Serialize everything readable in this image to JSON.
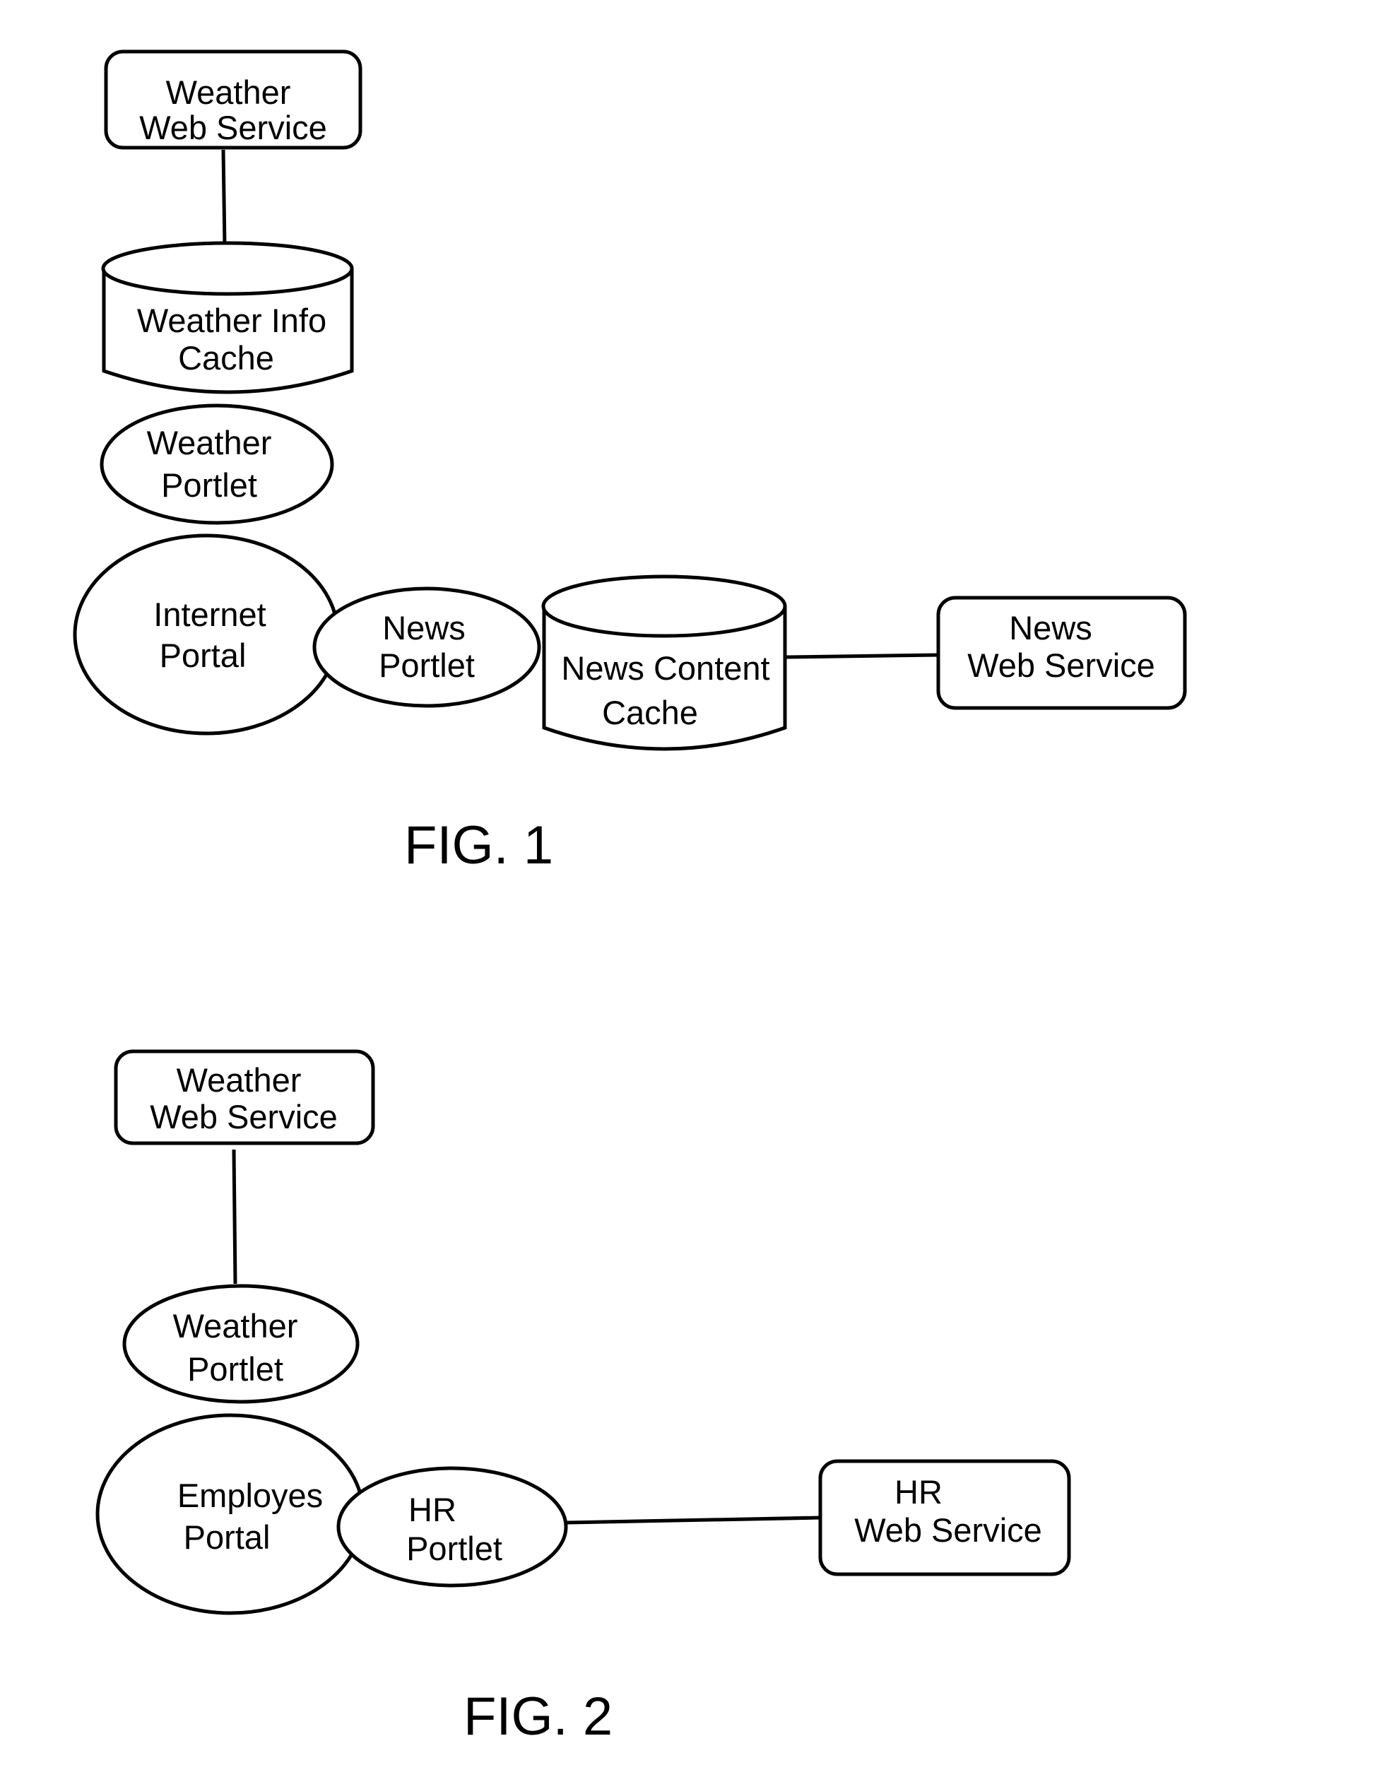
{
  "figures": [
    {
      "caption": "FIG. 1",
      "nodes": {
        "weather_web_service": {
          "type": "web-service",
          "lines": [
            "Weather",
            "Web Service"
          ]
        },
        "weather_info_cache": {
          "type": "cache",
          "lines": [
            "Weather Info",
            "Cache"
          ]
        },
        "weather_portlet": {
          "type": "portlet",
          "lines": [
            "Weather",
            "Portlet"
          ]
        },
        "internet_portal": {
          "type": "portal",
          "lines": [
            "Internet",
            "Portal"
          ]
        },
        "news_portlet": {
          "type": "portlet",
          "lines": [
            "News",
            "Portlet"
          ]
        },
        "news_content_cache": {
          "type": "cache",
          "lines": [
            "News Content",
            "Cache"
          ]
        },
        "news_web_service": {
          "type": "web-service",
          "lines": [
            "News",
            "Web Service"
          ]
        }
      },
      "edges": [
        [
          "weather_web_service",
          "weather_info_cache"
        ],
        [
          "news_content_cache",
          "news_web_service"
        ]
      ]
    },
    {
      "caption": "FIG. 2",
      "nodes": {
        "weather_web_service": {
          "type": "web-service",
          "lines": [
            "Weather",
            "Web Service"
          ]
        },
        "weather_portlet": {
          "type": "portlet",
          "lines": [
            "Weather",
            "Portlet"
          ]
        },
        "employes_portal": {
          "type": "portal",
          "lines": [
            "Employes",
            "Portal"
          ]
        },
        "hr_portlet": {
          "type": "portlet",
          "lines": [
            "HR",
            "Portlet"
          ]
        },
        "hr_web_service": {
          "type": "web-service",
          "lines": [
            "HR",
            "Web Service"
          ]
        }
      },
      "edges": [
        [
          "weather_web_service",
          "weather_portlet"
        ],
        [
          "hr_portlet",
          "hr_web_service"
        ]
      ]
    }
  ]
}
